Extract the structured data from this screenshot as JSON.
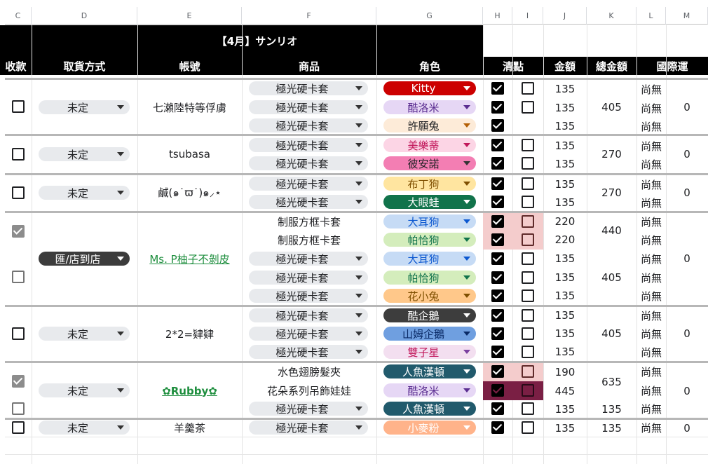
{
  "columns": [
    "C",
    "D",
    "E",
    "F",
    "G",
    "H",
    "I",
    "J",
    "K",
    "L",
    "M"
  ],
  "title": "【4月】サンリオ",
  "headers": {
    "receipt": "收款",
    "pickup": "取貨方式",
    "account": "帳號",
    "product": "商品",
    "character": "角色",
    "check": "清點",
    "amount": "金額",
    "total": "總金額",
    "intl": "國際運"
  },
  "products": {
    "p0": "極光硬卡套",
    "p1": "極光硬卡套",
    "p2": "極光硬卡套",
    "p3": "極光硬卡套",
    "p4": "極光硬卡套",
    "p5": "極光硬卡套",
    "p6": "極光硬卡套",
    "p7": "制服方框卡套",
    "p8": "制服方框卡套",
    "p9": "極光硬卡套",
    "p10": "極光硬卡套",
    "p11": "極光硬卡套",
    "p12": "極光硬卡套",
    "p13": "極光硬卡套",
    "p14": "極光硬卡套",
    "p15": "水色翅膀髮夾",
    "p16": "花朵系列吊飾娃娃",
    "p17": "極光硬卡套",
    "p18": "極光硬卡套"
  },
  "characters": {
    "c0": "Kitty",
    "c1": "酷洛米",
    "c2": "許願兔",
    "c3": "美樂蒂",
    "c4": "彼安諾",
    "c5": "布丁狗",
    "c6": "大眼蛙",
    "c7": "大耳狗",
    "c8": "帕恰狗",
    "c9": "大耳狗",
    "c10": "帕恰狗",
    "c11": "花小兔",
    "c12": "酷企鵝",
    "c13": "山姆企鵝",
    "c14": "雙子星",
    "c15": "人魚漢頓",
    "c16": "酷洛米",
    "c17": "人魚漢頓",
    "c18": "小麥粉"
  },
  "amounts": {
    "a0": "135",
    "a1": "135",
    "a2": "135",
    "a3": "135",
    "a4": "135",
    "a5": "135",
    "a6": "135",
    "a7": "220",
    "a8": "220",
    "a9": "135",
    "a10": "135",
    "a11": "135",
    "a12": "135",
    "a13": "135",
    "a14": "135",
    "a15": "190",
    "a16": "445",
    "a17": "135",
    "a18": "135"
  },
  "intl": {
    "i0": "尚無",
    "i1": "尚無",
    "i2": "尚無",
    "i3": "尚無",
    "i4": "尚無",
    "i5": "尚無",
    "i6": "尚無",
    "i7": "尚無",
    "i8": "尚無",
    "i9": "尚無",
    "i10": "尚無",
    "i11": "尚無",
    "i12": "尚無",
    "i13": "尚無",
    "i14": "尚無",
    "i15": "尚無",
    "i16": "尚無",
    "i17": "尚無",
    "i18": "尚無"
  },
  "orders": {
    "o0": {
      "pickup": "未定",
      "account": "七瀨陸特等俘虜",
      "total": "405",
      "intl": "0"
    },
    "o1": {
      "pickup": "未定",
      "account": "tsubasa",
      "total": "270",
      "intl": "0"
    },
    "o2": {
      "pickup": "未定",
      "account": "鹹(๑˙ϖ˙)๑⸝⋆",
      "total": "270",
      "intl": "0"
    },
    "o3": {
      "pickup": "匯/店到店",
      "account": "Ms. P柚子不剝皮",
      "total_a": "440",
      "total_b": "405",
      "intl": "0"
    },
    "o4": {
      "pickup": "未定",
      "account": "2*2=肄肄",
      "total": "405",
      "intl": "0"
    },
    "o5": {
      "pickup": "未定",
      "account": "✿Rubby✿",
      "total_a": "635",
      "total_b": "135",
      "intl": "0"
    },
    "o6": {
      "pickup": "未定",
      "account": "羊羹茶",
      "total": "135",
      "intl": "0"
    }
  },
  "colors": {
    "header_band": "#000000",
    "link": "#1e8e3e",
    "check_highlight": "#f4cccc",
    "check_dark": "#7a1f44",
    "chip_default": "#e8eaed"
  }
}
